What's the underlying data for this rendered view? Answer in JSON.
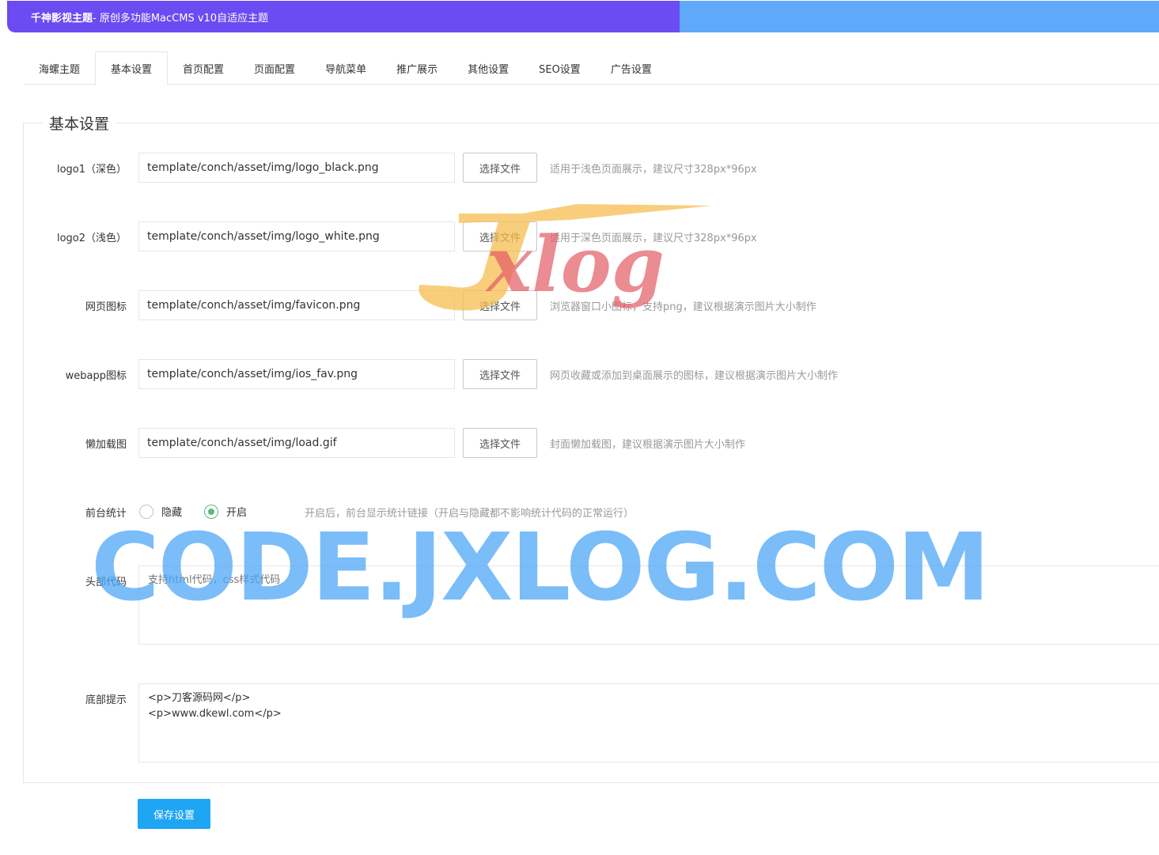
{
  "header": {
    "brand": "千神影视主题",
    "subtitle": " - 原创多功能MacCMS v10自适应主题",
    "left_color": "#6b4bf2",
    "right_color": "#5fa8fa"
  },
  "tabs": [
    {
      "label": "海螺主题",
      "active": false
    },
    {
      "label": "基本设置",
      "active": true
    },
    {
      "label": "首页配置",
      "active": false
    },
    {
      "label": "页面配置",
      "active": false
    },
    {
      "label": "导航菜单",
      "active": false
    },
    {
      "label": "推广展示",
      "active": false
    },
    {
      "label": "其他设置",
      "active": false
    },
    {
      "label": "SEO设置",
      "active": false
    },
    {
      "label": "广告设置",
      "active": false
    }
  ],
  "section": {
    "legend": "基本设置"
  },
  "file_fields": [
    {
      "label": "logo1（深色）",
      "value": "template/conch/asset/img/logo_black.png",
      "button": "选择文件",
      "hint": "适用于浅色页面展示，建议尺寸328px*96px"
    },
    {
      "label": "logo2（浅色）",
      "value": "template/conch/asset/img/logo_white.png",
      "button": "选择文件",
      "hint": "适用于深色页面展示，建议尺寸328px*96px"
    },
    {
      "label": "网页图标",
      "value": "template/conch/asset/img/favicon.png",
      "button": "选择文件",
      "hint": "浏览器窗口小图标，支持png，建议根据演示图片大小制作"
    },
    {
      "label": "webapp图标",
      "value": "template/conch/asset/img/ios_fav.png",
      "button": "选择文件",
      "hint": "网页收藏或添加到桌面展示的图标，建议根据演示图片大小制作"
    },
    {
      "label": "懒加载图",
      "value": "template/conch/asset/img/load.gif",
      "button": "选择文件",
      "hint": "封面懒加载图，建议根据演示图片大小制作"
    }
  ],
  "stats": {
    "label": "前台统计",
    "option_hide": "隐藏",
    "option_show": "开启",
    "selected": "开启",
    "hint": "开启后，前台显示统计链接（开启与隐藏都不影响统计代码的正常运行）",
    "accent": "#5fb878"
  },
  "head_code": {
    "label": "头部代码",
    "placeholder": "支持html代码，css样式代码",
    "value": ""
  },
  "footer_tip": {
    "label": "底部提示",
    "value": "<p>刀客源码网</p>\n<p>www.dkewl.com</p>"
  },
  "save_button": {
    "label": "保存设置",
    "color": "#1ea5f4"
  },
  "watermarks": {
    "big": "CODE.JXLOG.COM",
    "logo": "Jxlog"
  }
}
